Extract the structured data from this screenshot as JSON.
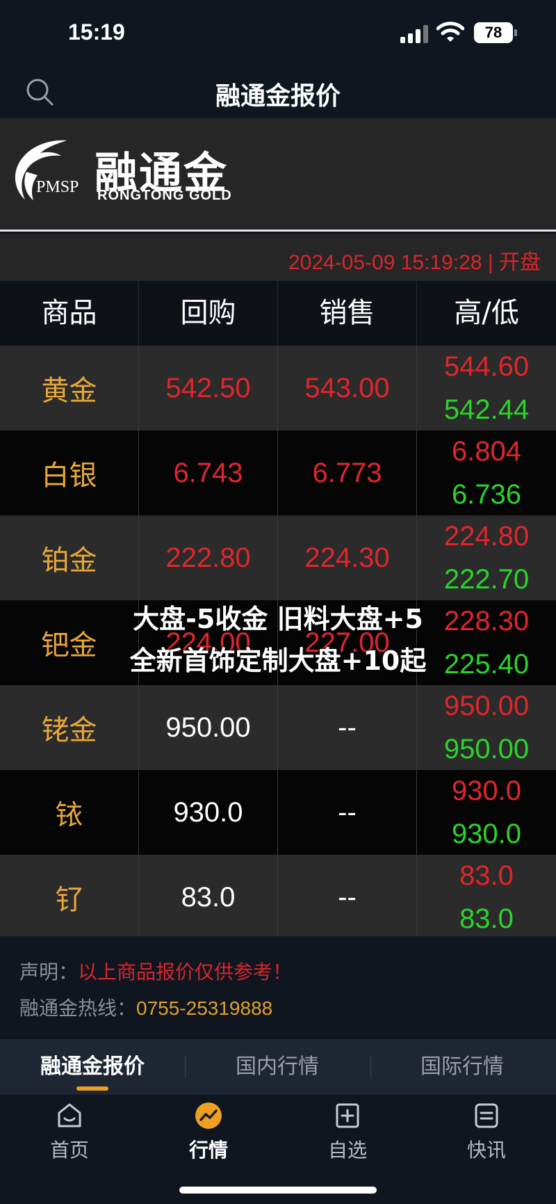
{
  "status": {
    "time": "15:19",
    "battery": "78"
  },
  "nav": {
    "title": "融通金报价"
  },
  "banner": {
    "logo_cn": "融通金",
    "logo_en": "RONGTONG  GOLD",
    "logo_pmsp": "PMSP"
  },
  "quote": {
    "datetime": "2024-05-09 15:19:28 | 开盘",
    "headers": [
      "商品",
      "回购",
      "销售",
      "高/低"
    ],
    "rows": [
      {
        "name": "黄金",
        "buy": "542.50",
        "sell": "543.00",
        "high": "544.60",
        "low": "542.44"
      },
      {
        "name": "白银",
        "buy": "6.743",
        "sell": "6.773",
        "high": "6.804",
        "low": "6.736"
      },
      {
        "name": "铂金",
        "buy": "222.80",
        "sell": "224.30",
        "high": "224.80",
        "low": "222.70"
      },
      {
        "name": "钯金",
        "buy": "224.00",
        "sell": "227.00",
        "high": "228.30",
        "low": "225.40"
      },
      {
        "name": "铑金",
        "buy": "950.00",
        "sell": "--",
        "high": "950.00",
        "low": "950.00"
      },
      {
        "name": "铱",
        "buy": "930.0",
        "sell": "--",
        "high": "930.0",
        "low": "930.0"
      },
      {
        "name": "钌",
        "buy": "83.0",
        "sell": "--",
        "high": "83.0",
        "low": "83.0"
      }
    ]
  },
  "overlay": {
    "line1": "大盘-5收金  旧料大盘+5",
    "line2": "全新首饰定制大盘+10起"
  },
  "footer": {
    "disclaimer_label": "声明：",
    "disclaimer_text": "以上商品报价仅供参考！",
    "hotline_label": "融通金热线：",
    "hotline_number": "0755-25319888"
  },
  "subtabs": [
    "融通金报价",
    "国内行情",
    "国际行情"
  ],
  "tabbar": [
    {
      "label": "首页",
      "icon": "home-icon"
    },
    {
      "label": "行情",
      "icon": "market-icon"
    },
    {
      "label": "自选",
      "icon": "watchlist-add-icon"
    },
    {
      "label": "快讯",
      "icon": "news-icon"
    }
  ],
  "colors": {
    "accent": "#f0a020",
    "price_red": "#e0262b",
    "price_green": "#2ad42a",
    "name_gold": "#e8a838"
  }
}
